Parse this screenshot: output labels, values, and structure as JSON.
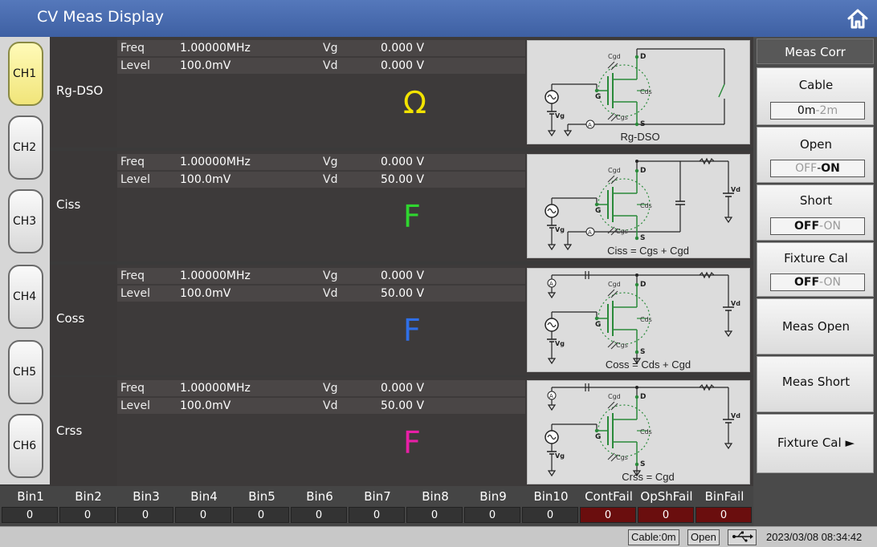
{
  "title": "CV Meas Display",
  "icons": {
    "home": "home-icon",
    "usb": "usb-icon"
  },
  "channels": [
    {
      "label": "CH1",
      "active": true
    },
    {
      "label": "CH2",
      "active": false
    },
    {
      "label": "CH3",
      "active": false
    },
    {
      "label": "CH4",
      "active": false
    },
    {
      "label": "CH5",
      "active": false
    },
    {
      "label": "CH6",
      "active": false
    }
  ],
  "param_labels": {
    "freq": "Freq",
    "level": "Level",
    "vg": "Vg",
    "vd": "Vd"
  },
  "panels": [
    {
      "name": "Rg-DSO",
      "freq": "1.00000MHz",
      "level": "100.0mV",
      "vg": "0.000 V",
      "vd": "0.000 V",
      "unit": "Ω",
      "unit_color": "#f2e300",
      "diagram_label": "Rg-DSO"
    },
    {
      "name": "Ciss",
      "freq": "1.00000MHz",
      "level": "100.0mV",
      "vg": "0.000 V",
      "vd": "50.00 V",
      "unit": "F",
      "unit_color": "#2fd62f",
      "diagram_label": "Ciss = Cgs + Cgd"
    },
    {
      "name": "Coss",
      "freq": "1.00000MHz",
      "level": "100.0mV",
      "vg": "0.000 V",
      "vd": "50.00 V",
      "unit": "F",
      "unit_color": "#2f6fe8",
      "diagram_label": "Coss = Cds + Cgd"
    },
    {
      "name": "Crss",
      "freq": "1.00000MHz",
      "level": "100.0mV",
      "vg": "0.000 V",
      "vd": "50.00 V",
      "unit": "F",
      "unit_color": "#e81fa6",
      "diagram_label": "Crss = Cgd"
    }
  ],
  "circuit_labels": {
    "cgd": "Cgd",
    "cds": "Cds",
    "cgs": "Cgs",
    "d": "D",
    "g": "G",
    "s": "S",
    "vg": "Vg",
    "vd": "Vd",
    "ammeter": "A"
  },
  "menu": {
    "header": "Meas Corr",
    "cable": {
      "label": "Cable",
      "on": "0m",
      "sep": "-",
      "off": "2m"
    },
    "open": {
      "label": "Open",
      "off": "OFF",
      "sep": "-",
      "on": "ON"
    },
    "short": {
      "label": "Short",
      "off": "OFF",
      "sep": "-",
      "on": "ON"
    },
    "fixture_cal": {
      "label": "Fixture Cal",
      "off": "OFF",
      "sep": "-",
      "on": "ON"
    },
    "meas_open": "Meas Open",
    "meas_short": "Meas Short",
    "fixture_cal_sub": "Fixture Cal",
    "arrow": "►"
  },
  "bins": [
    {
      "name": "Bin1",
      "value": "0",
      "fail": false
    },
    {
      "name": "Bin2",
      "value": "0",
      "fail": false
    },
    {
      "name": "Bin3",
      "value": "0",
      "fail": false
    },
    {
      "name": "Bin4",
      "value": "0",
      "fail": false
    },
    {
      "name": "Bin5",
      "value": "0",
      "fail": false
    },
    {
      "name": "Bin6",
      "value": "0",
      "fail": false
    },
    {
      "name": "Bin7",
      "value": "0",
      "fail": false
    },
    {
      "name": "Bin8",
      "value": "0",
      "fail": false
    },
    {
      "name": "Bin9",
      "value": "0",
      "fail": false
    },
    {
      "name": "Bin10",
      "value": "0",
      "fail": false
    },
    {
      "name": "ContFail",
      "value": "0",
      "fail": true
    },
    {
      "name": "OpShFail",
      "value": "0",
      "fail": true
    },
    {
      "name": "BinFail",
      "value": "0",
      "fail": true
    }
  ],
  "status": {
    "cable": "Cable:0m",
    "open": "Open",
    "datetime": "2023/03/08 08:34:42"
  }
}
